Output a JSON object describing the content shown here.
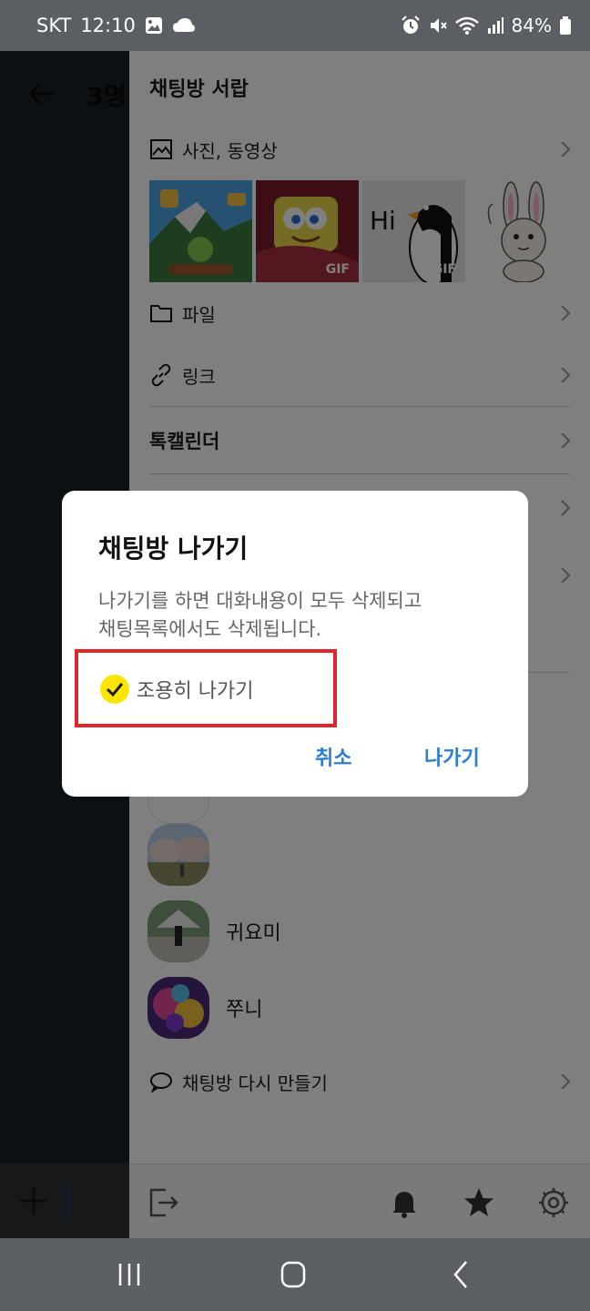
{
  "status_bar": {
    "carrier": "SKT",
    "time": "12:10",
    "battery": "84%",
    "icons_left": [
      "gallery-icon",
      "cloud-icon"
    ],
    "icons_right": [
      "alarm-icon",
      "mute-icon",
      "wifi-icon",
      "signal-icon",
      "battery-icon"
    ]
  },
  "chat": {
    "title": "3명"
  },
  "drawer": {
    "title": "채팅방 서랍",
    "photos_label": "사진, 동영상",
    "media": [
      {
        "gif": ""
      },
      {
        "gif": "GIF"
      },
      {
        "gif": "GIF"
      },
      {
        "gif": ""
      }
    ],
    "files_label": "파일",
    "links_label": "링크",
    "calendar_label": "톡캘린더",
    "members": [
      {
        "name": ""
      },
      {
        "name": "귀요미"
      },
      {
        "name": "쭈니"
      }
    ],
    "recreate_label": "채팅방 다시 만들기"
  },
  "dialog": {
    "title": "채팅방 나가기",
    "message_line1": "나가기를 하면 대화내용이 모두 삭제되고",
    "message_line2": "채팅목록에서도 삭제됩니다.",
    "quiet_leave_label": "조용히 나가기",
    "quiet_leave_checked": true,
    "cancel_label": "취소",
    "leave_label": "나가기"
  },
  "colors": {
    "accent_blue": "#2d7dd2",
    "check_yellow": "#fee500",
    "highlight_red": "#e0262b"
  }
}
